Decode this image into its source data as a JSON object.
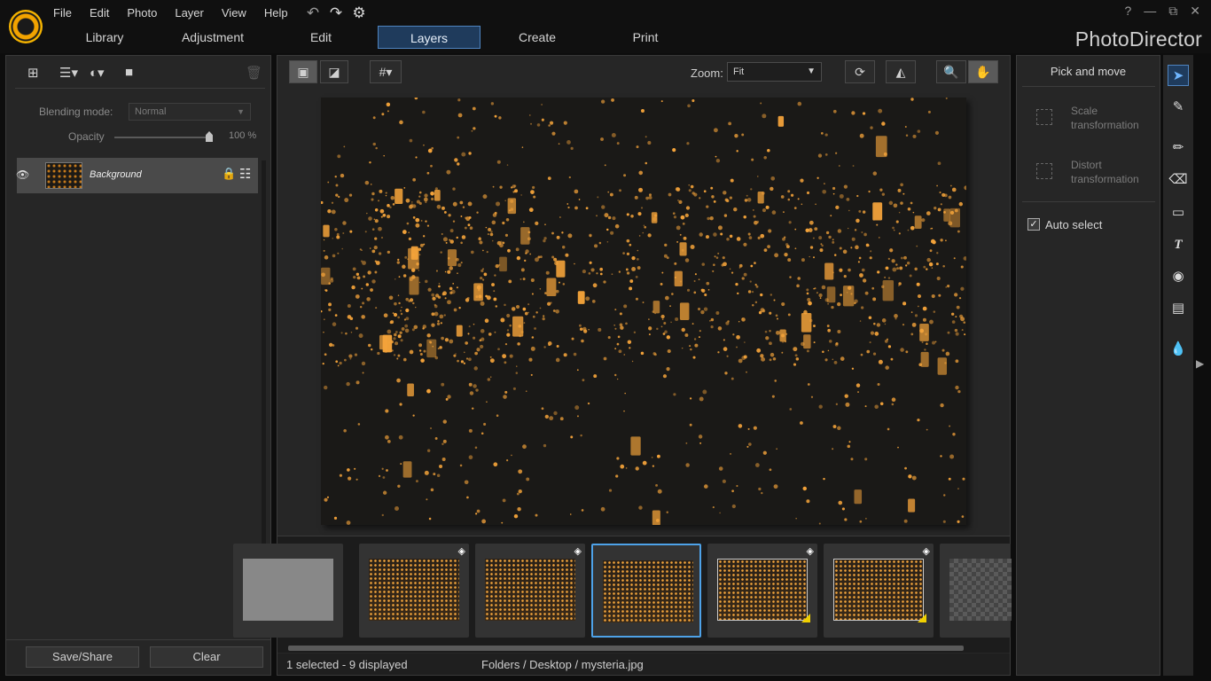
{
  "menu": [
    "File",
    "Edit",
    "Photo",
    "Layer",
    "View",
    "Help"
  ],
  "quick_actions": {
    "undo": "↶",
    "redo": "↷",
    "settings": "⚙"
  },
  "window_controls": {
    "help": "?",
    "minimize": "—",
    "restore": "⧉",
    "close": "✕"
  },
  "tabs": [
    {
      "label": "Library"
    },
    {
      "label": "Adjustment"
    },
    {
      "label": "Edit"
    },
    {
      "label": "Layers",
      "active": true
    },
    {
      "label": "Create"
    },
    {
      "label": "Print"
    }
  ],
  "brand": "PhotoDirector",
  "layers_panel": {
    "blending_label": "Blending mode:",
    "blending_value": "Normal",
    "opacity_label": "Opacity",
    "opacity_value": "100 %",
    "opacity_level": 1.0,
    "layer_name": "Background",
    "save_label": "Save/Share",
    "clear_label": "Clear"
  },
  "viewer": {
    "zoom_label": "Zoom:",
    "zoom_value": "Fit"
  },
  "status": {
    "selection": "1 selected - 9 displayed",
    "path": "Folders / Desktop / mysteria.jpg"
  },
  "right_panel": {
    "title": "Pick and move",
    "scale_label": "Scale\ntransformation",
    "distort_label": "Distort\ntransformation",
    "auto_select_label": "Auto select",
    "auto_select_checked": true
  },
  "colors": {
    "accent": "#4ea2e8",
    "tab_active_bg": "#1f3b5c",
    "lantern": "#f4a33a",
    "badge": "#f0d000"
  }
}
